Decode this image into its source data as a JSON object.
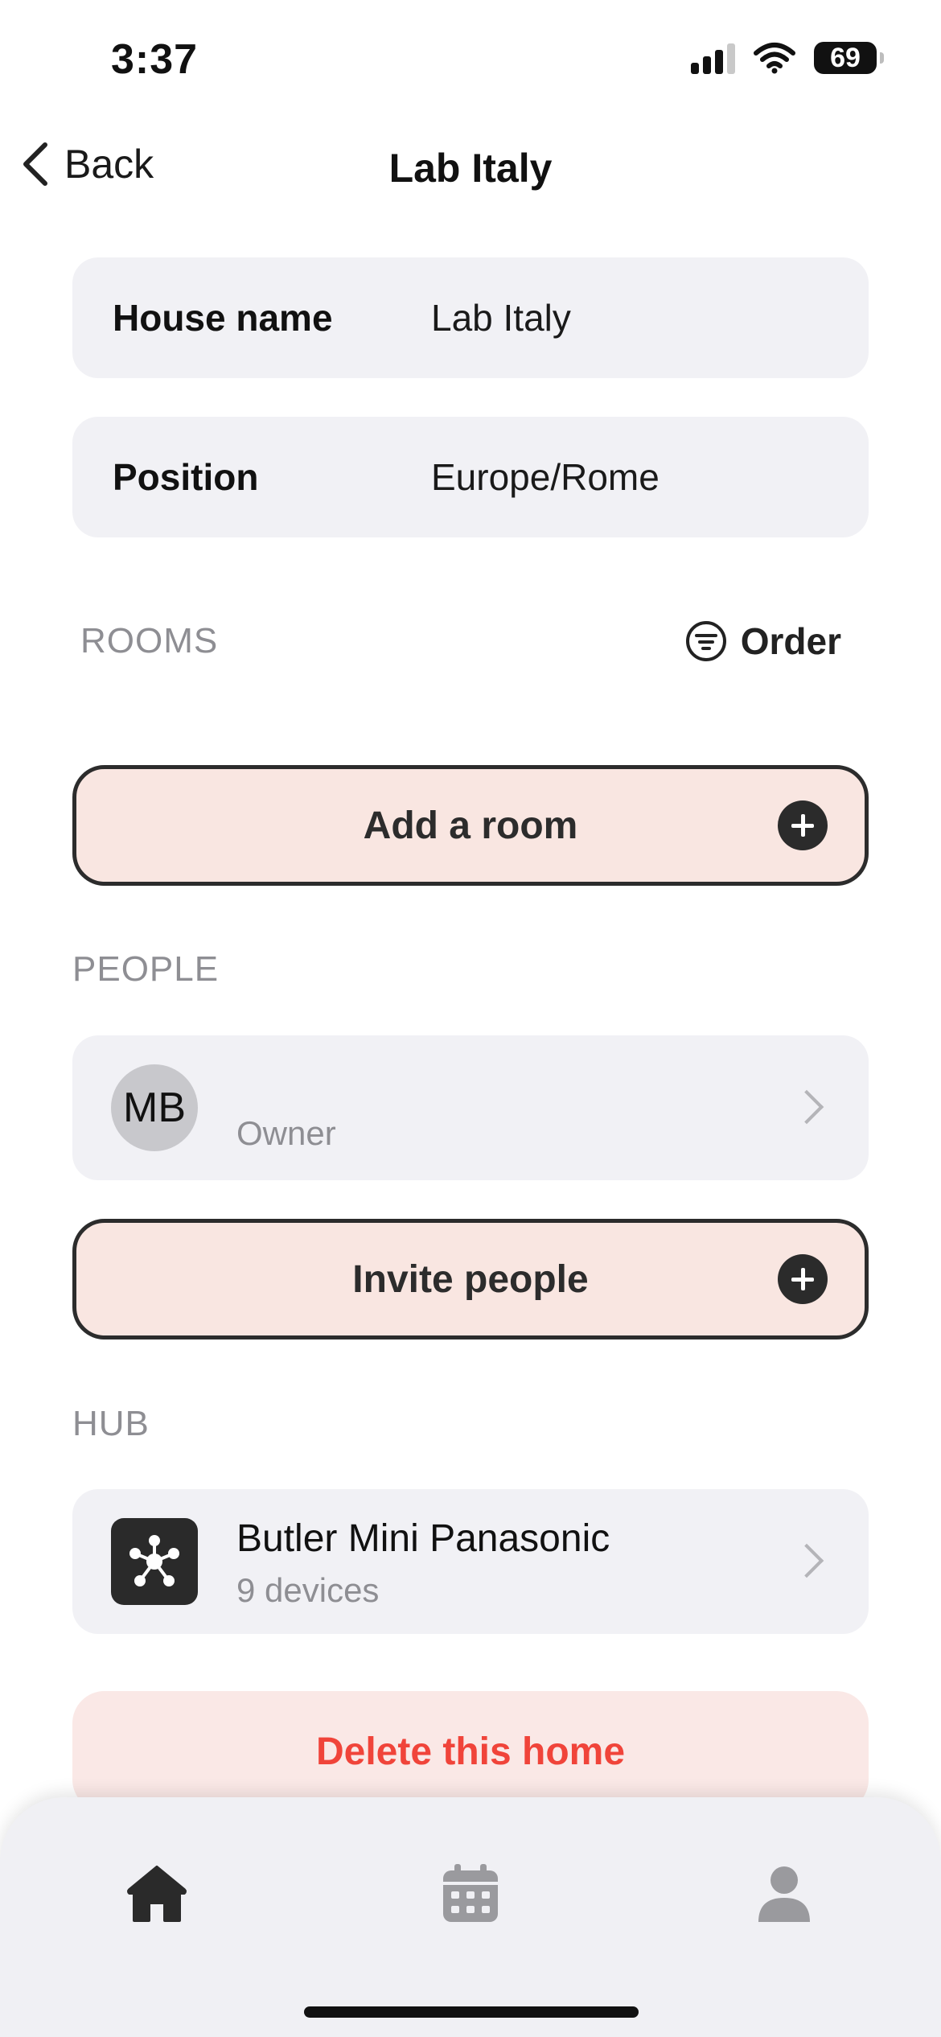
{
  "status_bar": {
    "time": "3:37",
    "battery": "69"
  },
  "nav": {
    "back_label": "Back",
    "title": "Lab Italy"
  },
  "house_fields": [
    {
      "label": "House name",
      "value": "Lab Italy"
    },
    {
      "label": "Position",
      "value": "Europe/Rome"
    }
  ],
  "rooms": {
    "section_title": "ROOMS",
    "order_label": "Order",
    "add_label": "Add a room"
  },
  "people": {
    "section_title": "PEOPLE",
    "member": {
      "initials": "MB",
      "role": "Owner"
    },
    "invite_label": "Invite people"
  },
  "hub": {
    "section_title": "HUB",
    "device": {
      "name": "Butler Mini Panasonic",
      "subtitle": "9 devices",
      "icon": "hub-icon"
    }
  },
  "delete_label": "Delete this home",
  "tab_bar": {
    "tabs": [
      {
        "icon": "home-icon",
        "active": true
      },
      {
        "icon": "calendar-icon",
        "active": false
      },
      {
        "icon": "profile-icon",
        "active": false
      }
    ]
  },
  "colors": {
    "accent_fill": "#f9e6e1",
    "card_bg": "#f1f1f5",
    "destructive": "#f0443a",
    "active_tab": "#2a2a2a",
    "inactive_tab": "#9a9a9e"
  }
}
